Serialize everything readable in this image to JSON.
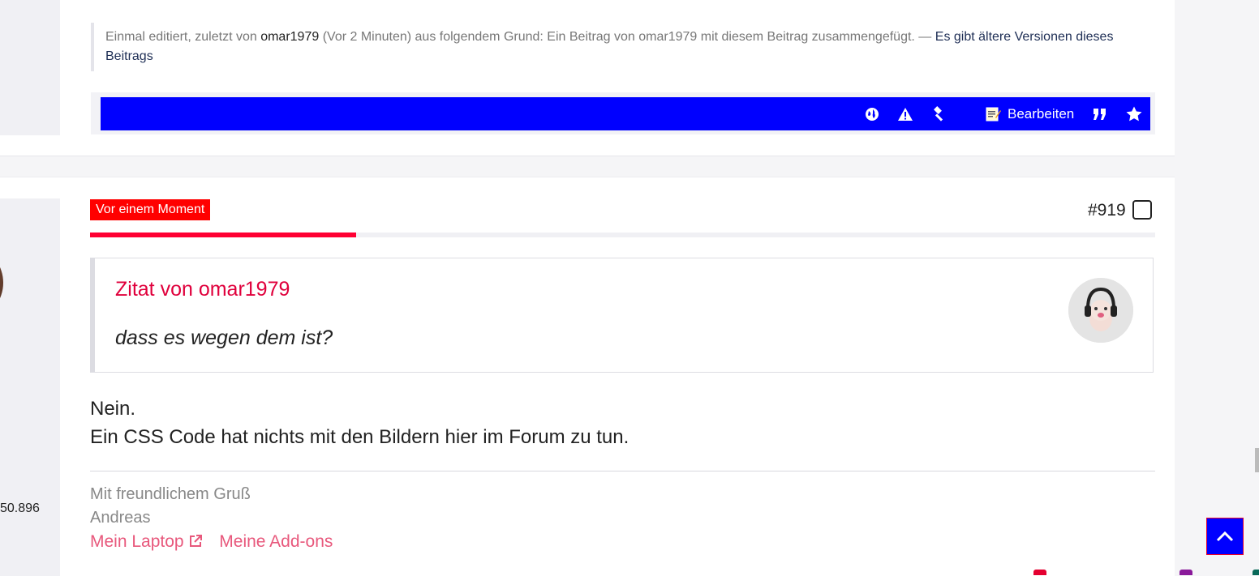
{
  "prev_post": {
    "edit_note": {
      "prefix": "Einmal editiert, zuletzt von",
      "user": "omar1979",
      "reason": "(Vor 2 Minuten) aus folgendem Grund: Ein Beitrag von omar1979 mit diesem Beitrag zusammengefügt. —",
      "versions_link": "Es gibt ältere Versionen dieses Beitrags"
    },
    "actions": {
      "edit_label": "Bearbeiten"
    }
  },
  "post": {
    "time_badge": "Vor einem Moment",
    "progress_fraction": 0.25,
    "number": "#919",
    "author_stat": "50.896",
    "quote": {
      "title": "Zitat von omar1979",
      "text": "dass es wegen dem ist?"
    },
    "message": {
      "line1": "Nein.",
      "line2": "Ein CSS Code hat nichts mit den Bildern hier im Forum zu tun."
    },
    "signature": {
      "greeting": "Mit freundlichem Gruß",
      "name": "Andreas",
      "link1": "Mein Laptop",
      "link2": "Meine Add-ons"
    }
  },
  "colors": {
    "action_bar": "#0000ff",
    "badge": "#ff0000",
    "accent": "#e0003c",
    "link": "#e8587c"
  },
  "icons": [
    "globe-icon",
    "warning-icon",
    "gavel-icon",
    "edit-note-icon",
    "quote-icon",
    "star-icon",
    "external-link-icon",
    "chevron-up-icon"
  ]
}
